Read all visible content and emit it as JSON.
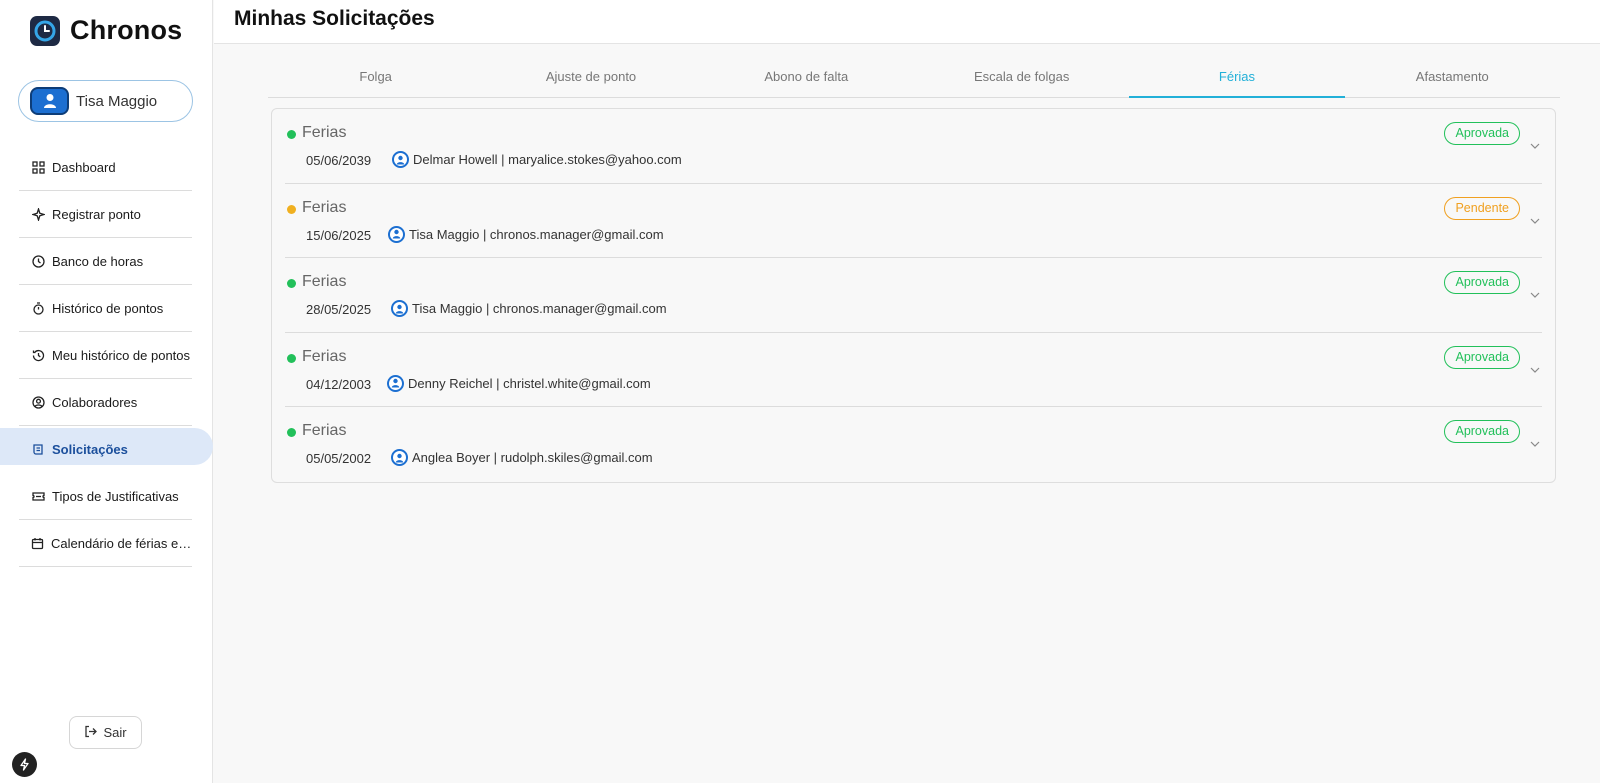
{
  "app": {
    "name": "Chronos",
    "user_name": "Tisa Maggio",
    "logout_label": "Sair"
  },
  "sidebar": {
    "items": [
      {
        "label": "Dashboard",
        "icon": "grid-icon"
      },
      {
        "label": "Registrar ponto",
        "icon": "sparkle-icon"
      },
      {
        "label": "Banco de horas",
        "icon": "clock-icon"
      },
      {
        "label": "Histórico de pontos",
        "icon": "stopwatch-icon"
      },
      {
        "label": "Meu histórico de pontos",
        "icon": "history-icon"
      },
      {
        "label": "Colaboradores",
        "icon": "user-circle-icon"
      },
      {
        "label": "Solicitações",
        "icon": "scroll-icon",
        "active": true
      },
      {
        "label": "Tipos de Justificativas",
        "icon": "ticket-icon"
      },
      {
        "label": "Calendário de férias e afastamentos",
        "icon": "calendar-icon"
      }
    ]
  },
  "header": {
    "title": "Minhas Solicitações"
  },
  "tabs": [
    {
      "label": "Folga"
    },
    {
      "label": "Ajuste de ponto"
    },
    {
      "label": "Abono de falta"
    },
    {
      "label": "Escala de folgas"
    },
    {
      "label": "Férias",
      "active": true
    },
    {
      "label": "Afastamento"
    }
  ],
  "requests": [
    {
      "type": "Ferias",
      "date": "05/06/2039",
      "person": "Delmar Howell | maryalice.stokes@yahoo.com",
      "status": "Aprovada",
      "status_kind": "ok"
    },
    {
      "type": "Ferias",
      "date": "15/06/2025",
      "person": "Tisa Maggio | chronos.manager@gmail.com",
      "status": "Pendente",
      "status_kind": "pend"
    },
    {
      "type": "Ferias",
      "date": "28/05/2025",
      "person": "Tisa Maggio | chronos.manager@gmail.com",
      "status": "Aprovada",
      "status_kind": "ok"
    },
    {
      "type": "Ferias",
      "date": "04/12/2003",
      "person": "Denny Reichel | christel.white@gmail.com",
      "status": "Aprovada",
      "status_kind": "ok"
    },
    {
      "type": "Ferias",
      "date": "05/05/2002",
      "person": "Anglea Boyer | rudolph.skiles@gmail.com",
      "status": "Aprovada",
      "status_kind": "ok"
    }
  ],
  "colors": {
    "accent": "#22b0d8",
    "approved": "#22c05a",
    "pending": "#f0a020",
    "active_nav_bg": "#dde8f8",
    "active_nav_text": "#1b4f9c"
  }
}
